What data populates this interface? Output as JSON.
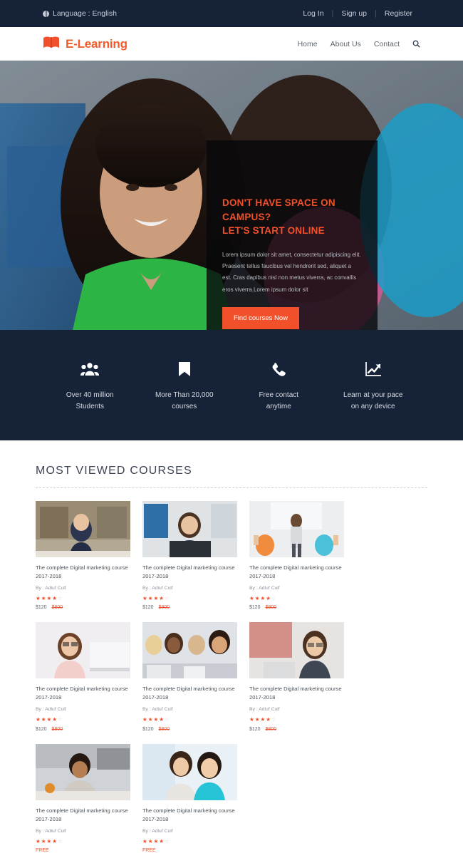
{
  "topbar": {
    "globe_icon": "globe-icon",
    "language_label": "Language : English",
    "links": [
      {
        "label": "Log In"
      },
      {
        "label": "Sign up"
      },
      {
        "label": "Register"
      }
    ],
    "separator": "|"
  },
  "header": {
    "logo_icon": "open-book-icon",
    "brand": "E-Learning",
    "nav": [
      {
        "label": "Home"
      },
      {
        "label": "About Us"
      },
      {
        "label": "Contact"
      }
    ],
    "search_icon": "search-icon"
  },
  "hero": {
    "title_line1": "DON'T HAVE SPACE ON CAMPUS?",
    "title_line2": "LET'S START ONLINE",
    "description": "Lorem ipsum dolor sit amet, consectetur adipiscing elit. Praesent tellus faucibus vel hendrerit sed, aliquet a est. Cras dapibus nisl non metus viverra, ac convallis eros viverra.Lorem ipsum dolor sit",
    "cta_label": "Find courses Now"
  },
  "features": [
    {
      "icon": "users-icon",
      "line1": "Over 40 million",
      "line2": "Students"
    },
    {
      "icon": "bookmark-icon",
      "line1": "More Than 20,000",
      "line2": "courses"
    },
    {
      "icon": "phone-icon",
      "line1": "Free contact",
      "line2": "anytime"
    },
    {
      "icon": "chart-line-icon",
      "line1": "Learn at your pace",
      "line2": "on any device"
    }
  ],
  "courses_section": {
    "title": "MOST VIEWED COURSES",
    "by_prefix": "By : ",
    "cards": [
      {
        "title": "The complete Digital marketing course",
        "year": "2017-2018",
        "author": "Adluf Culf",
        "rating": 4,
        "max_rating": 5,
        "price": "$120",
        "old_price": "$800",
        "free_label": ""
      },
      {
        "title": "The complete Digital marketing course",
        "year": "2017-2018",
        "author": "Adluf Culf",
        "rating": 4,
        "max_rating": 5,
        "price": "$120",
        "old_price": "$800",
        "free_label": ""
      },
      {
        "title": "The complete Digital marketing course",
        "year": "2017-2018",
        "author": "Adluf Culf",
        "rating": 4,
        "max_rating": 5,
        "price": "$120",
        "old_price": "$800",
        "free_label": ""
      },
      {
        "title": "The complete Digital marketing course",
        "year": "2017-2018",
        "author": "Adluf Culf",
        "rating": 4,
        "max_rating": 5,
        "price": "$120",
        "old_price": "$800",
        "free_label": ""
      },
      {
        "title": "The complete Digital marketing course",
        "year": "2017-2018",
        "author": "Adluf Culf",
        "rating": 4,
        "max_rating": 5,
        "price": "$120",
        "old_price": "$800",
        "free_label": ""
      },
      {
        "title": "The complete Digital marketing course",
        "year": "2017-2018",
        "author": "Adluf Culf",
        "rating": 4,
        "max_rating": 5,
        "price": "$120",
        "old_price": "$800",
        "free_label": ""
      },
      {
        "title": "The complete Digital marketing course",
        "year": "2017-2018",
        "author": "Adluf Culf",
        "rating": 4,
        "max_rating": 5,
        "price": "",
        "old_price": "",
        "free_label": "FREE"
      },
      {
        "title": "The complete Digital marketing course",
        "year": "2017-2018",
        "author": "Adluf Culf",
        "rating": 4,
        "max_rating": 5,
        "price": "",
        "old_price": "",
        "free_label": "FREE"
      }
    ]
  },
  "colors": {
    "navy": "#152238",
    "accent_orange": "#F1502A",
    "body_text": "#5c6470"
  }
}
